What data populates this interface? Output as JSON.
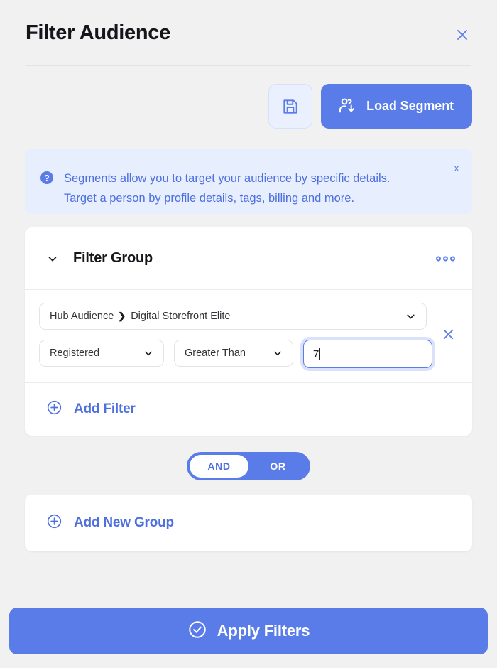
{
  "dialog": {
    "title": "Filter Audience",
    "close_icon": "close-x-icon"
  },
  "toolbar": {
    "save_icon": "floppy-disk-save-icon",
    "load_segment_label": "Load Segment",
    "load_segment_icon": "user-download-icon"
  },
  "banner": {
    "icon": "question-circle-icon",
    "line1": "Segments allow you to target your audience by specific details.",
    "line2": "Target a person by profile details, tags, billing and more.",
    "close_label": "x"
  },
  "filter_group": {
    "title": "Filter Group",
    "collapse_icon": "chevron-down-icon",
    "menu_icon": "three-dots-icon",
    "rows": [
      {
        "source_prefix": "Hub Audience",
        "source_separator": "❯",
        "source_value": "Digital Storefront Elite",
        "field": "Registered",
        "operator": "Greater Than",
        "value": "7"
      }
    ],
    "add_filter_label": "Add Filter",
    "add_filter_icon": "plus-circle-icon",
    "delete_row_icon": "close-x-icon"
  },
  "logic_toggle": {
    "options": [
      "AND",
      "OR"
    ],
    "selected": "AND"
  },
  "add_new_group": {
    "label": "Add New Group",
    "icon": "plus-circle-icon"
  },
  "apply": {
    "label": "Apply Filters",
    "icon": "check-circle-icon"
  },
  "colors": {
    "accent": "#5a7ce8",
    "accent_text": "#4d6fe0",
    "banner_bg": "#e7eefd",
    "page_bg": "#f1f1f2",
    "card_bg": "#ffffff"
  }
}
